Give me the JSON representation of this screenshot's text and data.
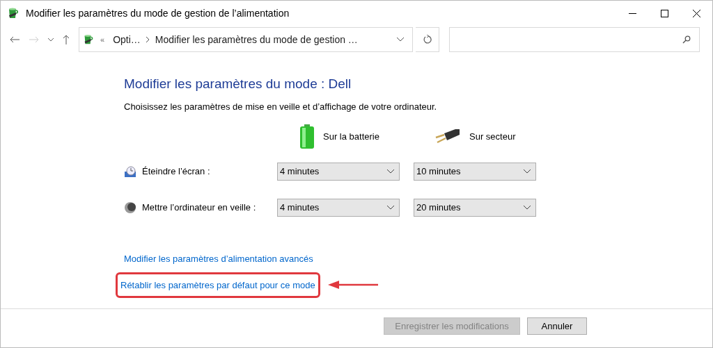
{
  "window": {
    "title": "Modifier les paramètres du mode de gestion de l’alimentation"
  },
  "address_bar": {
    "breadcrumbs": [
      {
        "text": "«",
        "kind": "overflow"
      },
      {
        "text": "Opti…",
        "kind": "crumb"
      },
      {
        "text": "Modifier les paramètres du mode de gestion …",
        "kind": "crumb"
      }
    ]
  },
  "heading": "Modifier les paramètres du mode : Dell",
  "description": "Choisissez les paramètres de mise en veille et d’affichage de votre ordinateur.",
  "columns": [
    {
      "label": "Sur la batterie",
      "kind": "battery"
    },
    {
      "label": "Sur secteur",
      "kind": "plug"
    }
  ],
  "settings": [
    {
      "label": "Éteindre l’écran :",
      "kind": "display",
      "values": [
        "4 minutes",
        "10 minutes"
      ]
    },
    {
      "label": "Mettre l’ordinateur en veille :",
      "kind": "sleep",
      "values": [
        "4 minutes",
        "20 minutes"
      ]
    }
  ],
  "links": [
    {
      "text": "Modifier les paramètres d’alimentation avancés",
      "highlighted": false
    },
    {
      "text": "Rétablir les paramètres par défaut pour ce mode",
      "highlighted": true
    }
  ],
  "buttons": [
    {
      "label": "Enregistrer les modifications",
      "disabled": true
    },
    {
      "label": "Annuler",
      "disabled": false
    }
  ]
}
